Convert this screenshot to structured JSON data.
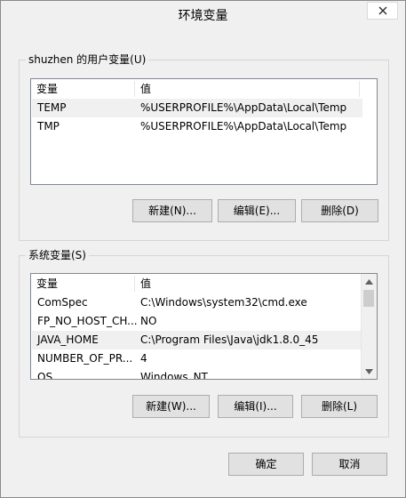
{
  "window": {
    "title": "环境变量"
  },
  "user_group": {
    "legend": "shuzhen 的用户变量(U)",
    "headers": {
      "name": "变量",
      "value": "值"
    },
    "rows": [
      {
        "name": "TEMP",
        "value": "%USERPROFILE%\\AppData\\Local\\Temp"
      },
      {
        "name": "TMP",
        "value": "%USERPROFILE%\\AppData\\Local\\Temp"
      }
    ],
    "buttons": {
      "new": "新建(N)...",
      "edit": "编辑(E)...",
      "delete": "删除(D)"
    }
  },
  "system_group": {
    "legend": "系统变量(S)",
    "headers": {
      "name": "变量",
      "value": "值"
    },
    "rows": [
      {
        "name": "ComSpec",
        "value": "C:\\Windows\\system32\\cmd.exe"
      },
      {
        "name": "FP_NO_HOST_CH...",
        "value": "NO"
      },
      {
        "name": "JAVA_HOME",
        "value": "C:\\Program Files\\Java\\jdk1.8.0_45"
      },
      {
        "name": "NUMBER_OF_PR...",
        "value": "4"
      },
      {
        "name": "OS",
        "value": "Windows_NT"
      }
    ],
    "buttons": {
      "new": "新建(W)...",
      "edit": "编辑(I)...",
      "delete": "删除(L)"
    }
  },
  "dialog_buttons": {
    "ok": "确定",
    "cancel": "取消"
  }
}
